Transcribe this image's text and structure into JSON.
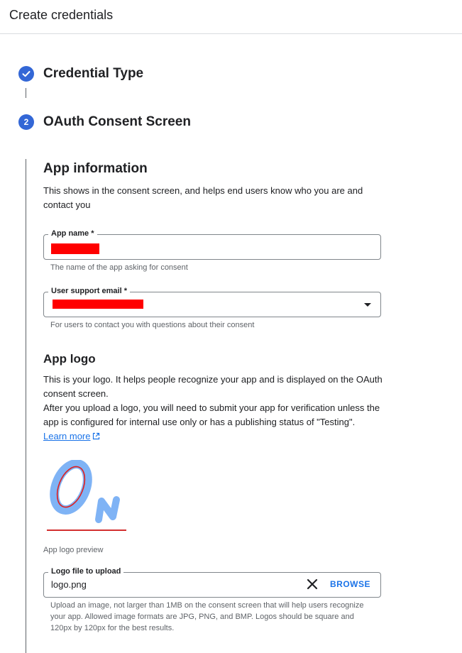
{
  "header": {
    "title": "Create credentials"
  },
  "steps": [
    {
      "label": "Credential Type",
      "state": "complete"
    },
    {
      "label": "OAuth Consent Screen",
      "number": "2",
      "state": "active"
    }
  ],
  "app_info": {
    "heading": "App information",
    "description": "This shows in the consent screen, and helps end users know who you are and contact you",
    "app_name": {
      "label": "App name *",
      "hint": "The name of the app asking for consent"
    },
    "support_email": {
      "label": "User support email *",
      "hint": "For users to contact you with questions about their consent"
    }
  },
  "app_logo": {
    "heading": "App logo",
    "description_1": "This is your logo. It helps people recognize your app and is displayed on the OAuth consent screen.",
    "description_2": "After you upload a logo, you will need to submit your app for verification unless the app is configured for internal use only or has a publishing status of \"Testing\".",
    "learn_more": "Learn more",
    "preview_caption": "App logo preview",
    "file_field": {
      "label": "Logo file to upload",
      "value": "logo.png",
      "browse_label": "BROWSE",
      "hint": "Upload an image, not larger than 1MB on the consent screen that will help users recognize your app. Allowed image formats are JPG, PNG, and BMP. Logos should be square and 120px by 120px for the best results."
    }
  },
  "colors": {
    "accent": "#3367d6",
    "link": "#1a73e8",
    "redaction": "#ff0000",
    "logo_blue": "#7fb3f5"
  }
}
